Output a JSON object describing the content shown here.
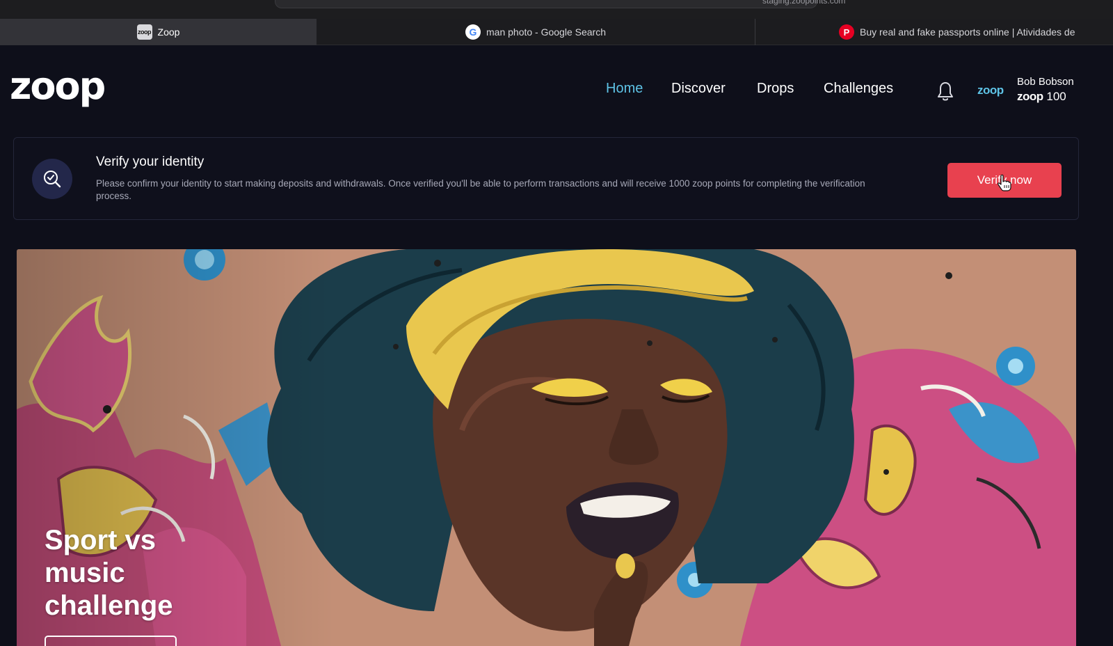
{
  "browser": {
    "address": "staging.zoopoints.com",
    "tabs": [
      {
        "title": "Zoop",
        "favicon": "zoop-favicon",
        "active": true
      },
      {
        "title": "man photo - Google Search",
        "favicon": "google-icon",
        "active": false
      },
      {
        "title": "Buy real and fake passports online | Atividades de",
        "favicon": "pinterest-icon",
        "active": false
      }
    ]
  },
  "header": {
    "logo": "zoop",
    "nav": [
      {
        "label": "Home",
        "active": true
      },
      {
        "label": "Discover",
        "active": false
      },
      {
        "label": "Drops",
        "active": false
      },
      {
        "label": "Challenges",
        "active": false
      }
    ],
    "notifications_icon": "bell-icon",
    "points_brand": "zoop",
    "user": {
      "name": "Bob Bobson",
      "points_brand": "zoop",
      "points": "100"
    }
  },
  "verify_banner": {
    "icon": "verify-identity-icon",
    "title": "Verify your identity",
    "description": "Please confirm your identity to start making deposits and withdrawals. Once verified you'll be able to perform transactions and will receive 1000 zoop points for completing the verification process.",
    "button_label": "Verify now"
  },
  "hero": {
    "image": "graffiti-mural-woman-yellow-cap",
    "title": "Sport vs music challenge"
  },
  "colors": {
    "background": "#0e0f1a",
    "accent": "#5ec3e6",
    "button": "#e8414f"
  }
}
